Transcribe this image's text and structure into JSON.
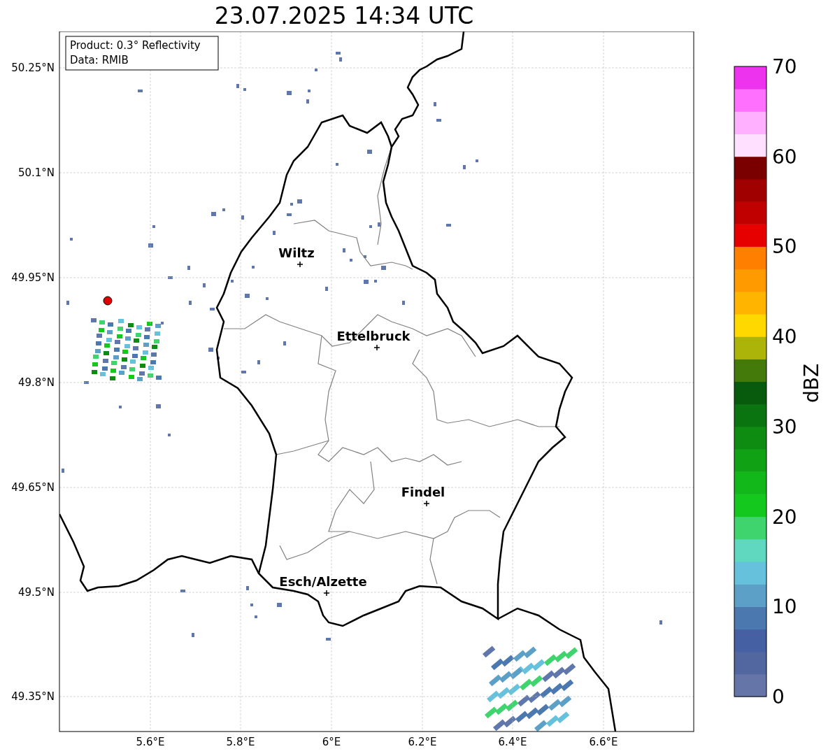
{
  "title": "23.07.2025 14:34 UTC",
  "info_box": {
    "lines": [
      "Product: 0.3° Reflectivity",
      "Data: RMIB"
    ]
  },
  "cities": [
    {
      "name": "Wiltz"
    },
    {
      "name": "Ettelbruck"
    },
    {
      "name": "Findel"
    },
    {
      "name": "Esch/Alzette"
    }
  ],
  "y_ticks": [
    "50.25°N",
    "50.1°N",
    "49.95°N",
    "49.8°N",
    "49.65°N",
    "49.5°N",
    "49.35°N"
  ],
  "x_ticks": [
    "5.6°E",
    "5.8°E",
    "6°E",
    "6.2°E",
    "6.4°E",
    "6.6°E"
  ],
  "colorbar": {
    "label": "dBZ",
    "ticks": [
      "70",
      "60",
      "50",
      "40",
      "30",
      "20",
      "10",
      "0"
    ],
    "levels": [
      {
        "color": "#6675a8"
      },
      {
        "color": "#52669f"
      },
      {
        "color": "#4560a3"
      },
      {
        "color": "#4c78b0"
      },
      {
        "color": "#5ca0c8"
      },
      {
        "color": "#66c2dc"
      },
      {
        "color": "#60d8c0"
      },
      {
        "color": "#3fd46e"
      },
      {
        "color": "#14c81e"
      },
      {
        "color": "#12b81a"
      },
      {
        "color": "#10a214"
      },
      {
        "color": "#0e8c12"
      },
      {
        "color": "#0a7410"
      },
      {
        "color": "#085a0c"
      },
      {
        "color": "#447a0a"
      },
      {
        "color": "#acb40a"
      },
      {
        "color": "#ffd800"
      },
      {
        "color": "#ffb400"
      },
      {
        "color": "#ff9a00"
      },
      {
        "color": "#ff8000"
      },
      {
        "color": "#e60000"
      },
      {
        "color": "#c00000"
      },
      {
        "color": "#a00000"
      },
      {
        "color": "#7a0000"
      },
      {
        "color": "#ffe0ff"
      },
      {
        "color": "#ffb0ff"
      },
      {
        "color": "#ff70ff"
      },
      {
        "color": "#ee33ee"
      }
    ]
  }
}
